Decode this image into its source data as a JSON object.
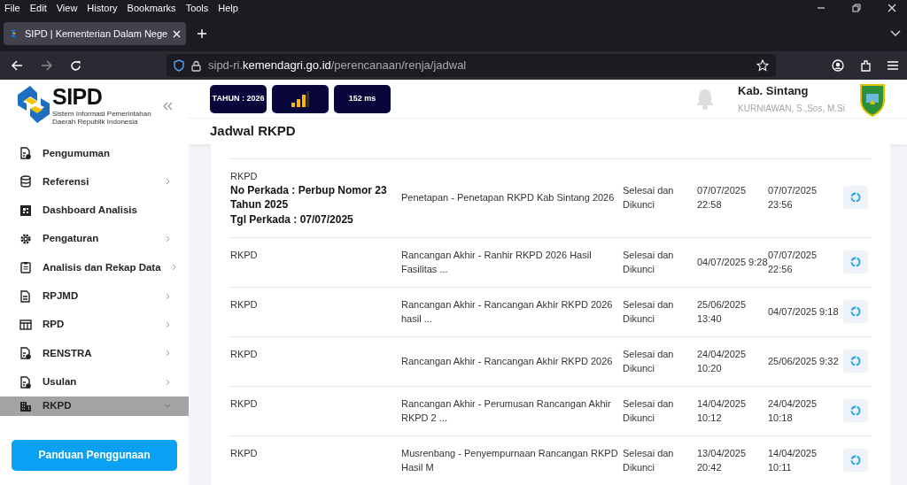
{
  "browser": {
    "menu": [
      "File",
      "Edit",
      "View",
      "History",
      "Bookmarks",
      "Tools",
      "Help"
    ],
    "tab": {
      "title": "SIPD | Kementerian Dalam Nege",
      "selected": true
    },
    "url": {
      "host_prefix": "sipd-ri.",
      "host": "kemendagri.go.id",
      "path": "/perencanaan/renja/jadwal"
    }
  },
  "sidebar": {
    "logo_text": "SIPD",
    "logo_subtitle": "Sistem Informasi Pemerintahan Daerah Republik Indonesia",
    "items": [
      {
        "label": "Pengumuman",
        "kind": "link",
        "selected": false
      },
      {
        "label": "Referensi",
        "kind": "group",
        "expanded": false,
        "selected": false
      },
      {
        "label": "Dashboard Analisis",
        "kind": "link",
        "selected": false
      },
      {
        "label": "Pengaturan",
        "kind": "group",
        "expanded": false,
        "selected": false
      },
      {
        "label": "Analisis dan Rekap Data",
        "kind": "group",
        "expanded": false,
        "selected": false
      },
      {
        "label": "RPJMD",
        "kind": "group",
        "expanded": false,
        "selected": false
      },
      {
        "label": "RPD",
        "kind": "group",
        "expanded": false,
        "selected": false
      },
      {
        "label": "RENSTRA",
        "kind": "group",
        "expanded": false,
        "selected": false
      },
      {
        "label": "Usulan",
        "kind": "group",
        "expanded": false,
        "selected": false
      },
      {
        "label": "RKPD",
        "kind": "group",
        "expanded": true,
        "selected": true
      }
    ],
    "button": "Panduan Penggunaan"
  },
  "header": {
    "year": "TAHUN : 2026",
    "latency": "152 ms",
    "region": "Kab. Sintang",
    "user": "KURNIAWAN, S.,Sos, M.Si"
  },
  "page_title": "Jadwal RKPD",
  "table": {
    "rows": [
      {
        "tahap": "RKPD",
        "perkada_no": "No Perkada : Perbup Nomor 23 Tahun 2025",
        "perkada_tgl": "Tgl Perkada : 07/07/2025",
        "sub_tahap": "Penetapan - Penetapan RKPD Kab Sintang 2026",
        "status": "Selesai dan Dikunci",
        "mulai": "07/07/2025 22:58",
        "selesai": "07/07/2025 23:56"
      },
      {
        "tahap": "RKPD",
        "sub_tahap": "Rancangan Akhir - Ranhir RKPD 2026 Hasil Fasilitas ...",
        "status": "Selesai dan Dikunci",
        "mulai": "04/07/2025 9:28",
        "selesai": "07/07/2025 22:56"
      },
      {
        "tahap": "RKPD",
        "sub_tahap": "Rancangan Akhir - Rancangan Akhir RKPD 2026 hasil ...",
        "status": "Selesai dan Dikunci",
        "mulai": "25/06/2025 13:40",
        "selesai": "04/07/2025 9:18"
      },
      {
        "tahap": "RKPD",
        "sub_tahap": "Rancangan Akhir - Rancangan Akhir RKPD 2026",
        "status": "Selesai dan Dikunci",
        "mulai": "24/04/2025 10:20",
        "selesai": "25/06/2025 9:32"
      },
      {
        "tahap": "RKPD",
        "sub_tahap": "Rancangan Akhir - Perumusan Rancangan Akhir RKPD 2 ...",
        "status": "Selesai dan Dikunci",
        "mulai": "14/04/2025 10:12",
        "selesai": "24/04/2025 10:18"
      },
      {
        "tahap": "RKPD",
        "sub_tahap": "Musrenbang - Penyempurnaan Rancangan RKPD Hasil M",
        "status": "Selesai dan Dikunci",
        "mulai": "13/04/2025 20:42",
        "selesai": "14/04/2025 10:11"
      }
    ]
  }
}
